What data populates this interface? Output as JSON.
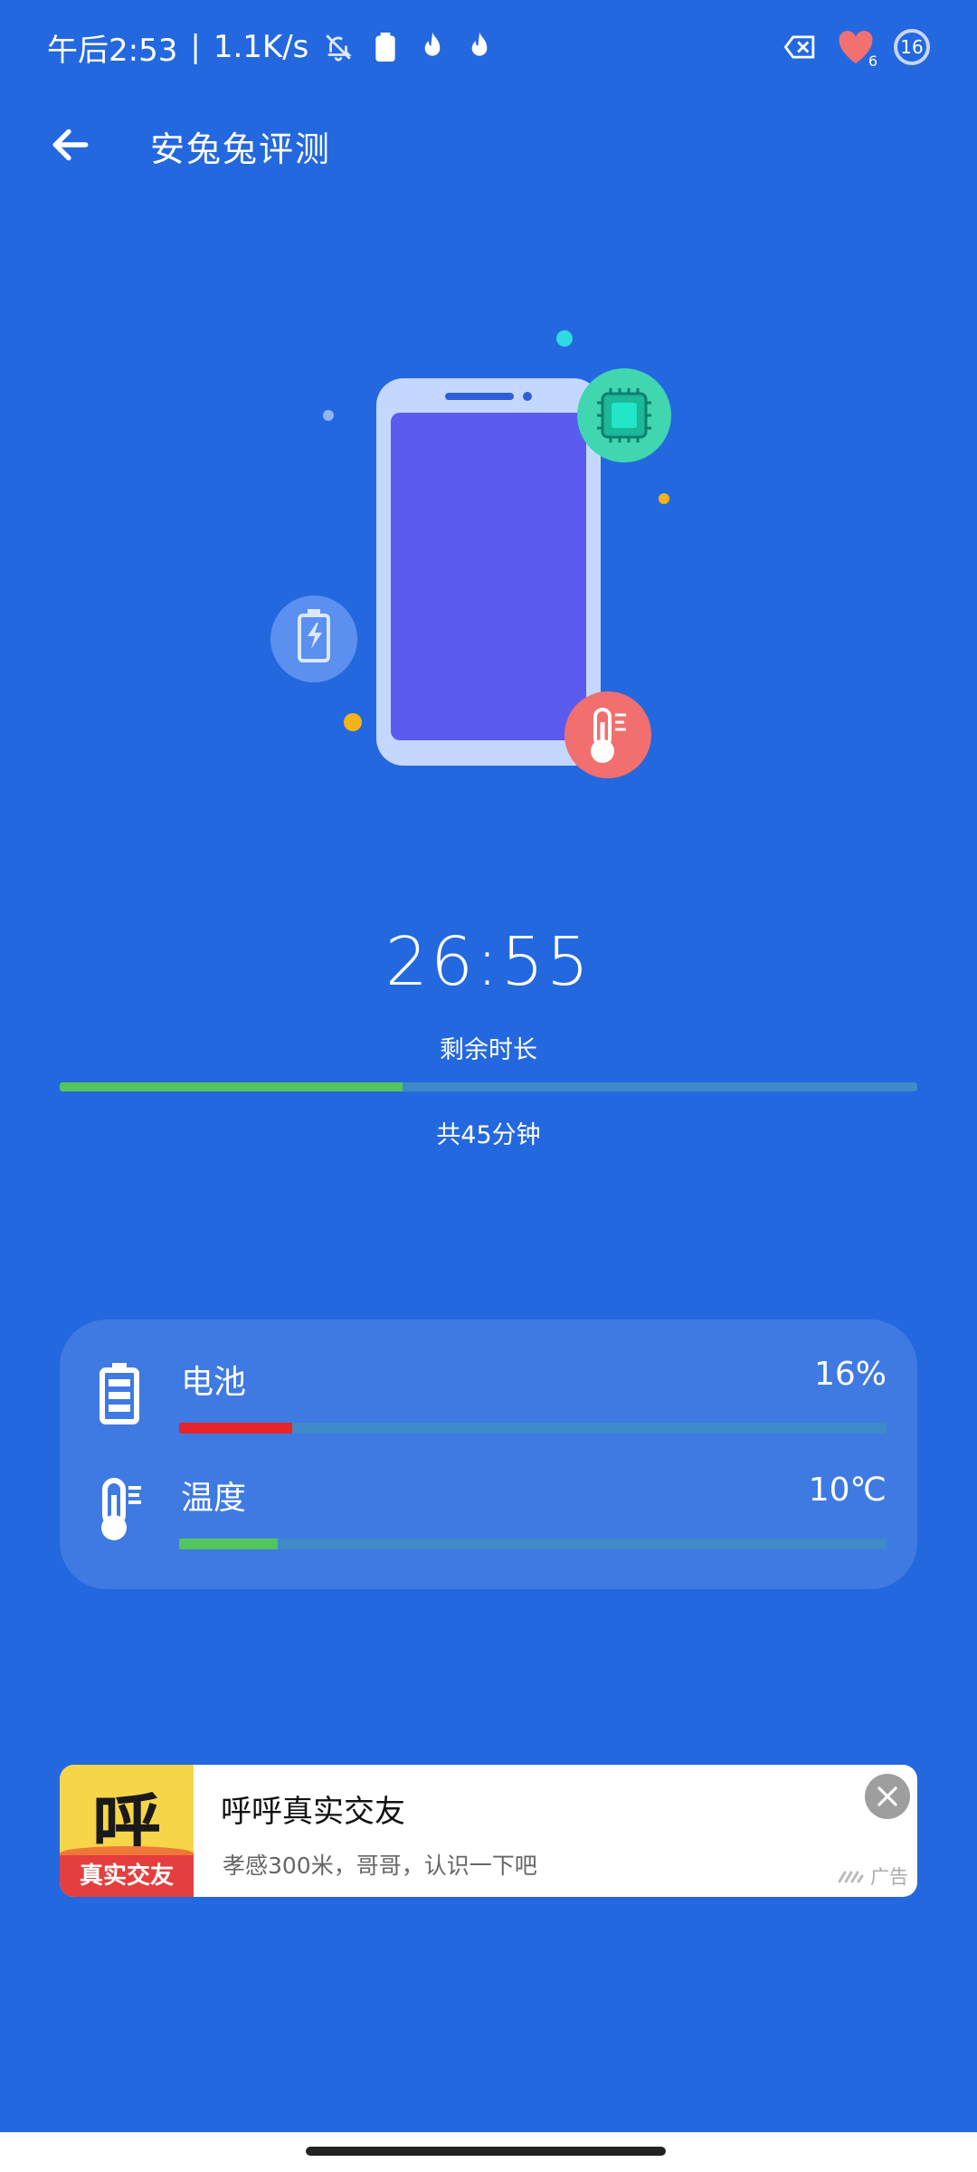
{
  "status_bar": {
    "time": "午后2:53",
    "separator": "|",
    "speed": "1.1K/s",
    "icons": [
      "bell-off-icon",
      "battery-small-icon",
      "flame-icon",
      "flame-icon",
      "close-box-icon",
      "heart-icon",
      "wifi-icon",
      "battery-ring-icon"
    ],
    "heart_badge": "6",
    "battery_level": "16"
  },
  "header": {
    "back_icon": "arrow-left-icon",
    "title": "安兔兔评测"
  },
  "timer": {
    "value": "26:55",
    "label": "剩余时长",
    "progress": 0.4,
    "total": "共45分钟"
  },
  "stats": {
    "battery": {
      "label": "电池",
      "value": "16%",
      "progress": 0.16,
      "color": "#E8232A",
      "icon": "battery-icon"
    },
    "temperature": {
      "label": "温度",
      "value": "10℃",
      "progress": 0.14,
      "color": "#52C55C",
      "icon": "thermometer-icon"
    }
  },
  "ad": {
    "logo_char": "呼",
    "logo_caption": "真实交友",
    "title": "呼呼真实交友",
    "subtitle": "孝感300米，哥哥，认识一下吧",
    "tag": "广告",
    "close_icon": "close-icon"
  },
  "colors": {
    "background": "#2468DF",
    "track": "#3F8AC9",
    "progress_green": "#52C55C",
    "battery_red": "#E8232A"
  }
}
